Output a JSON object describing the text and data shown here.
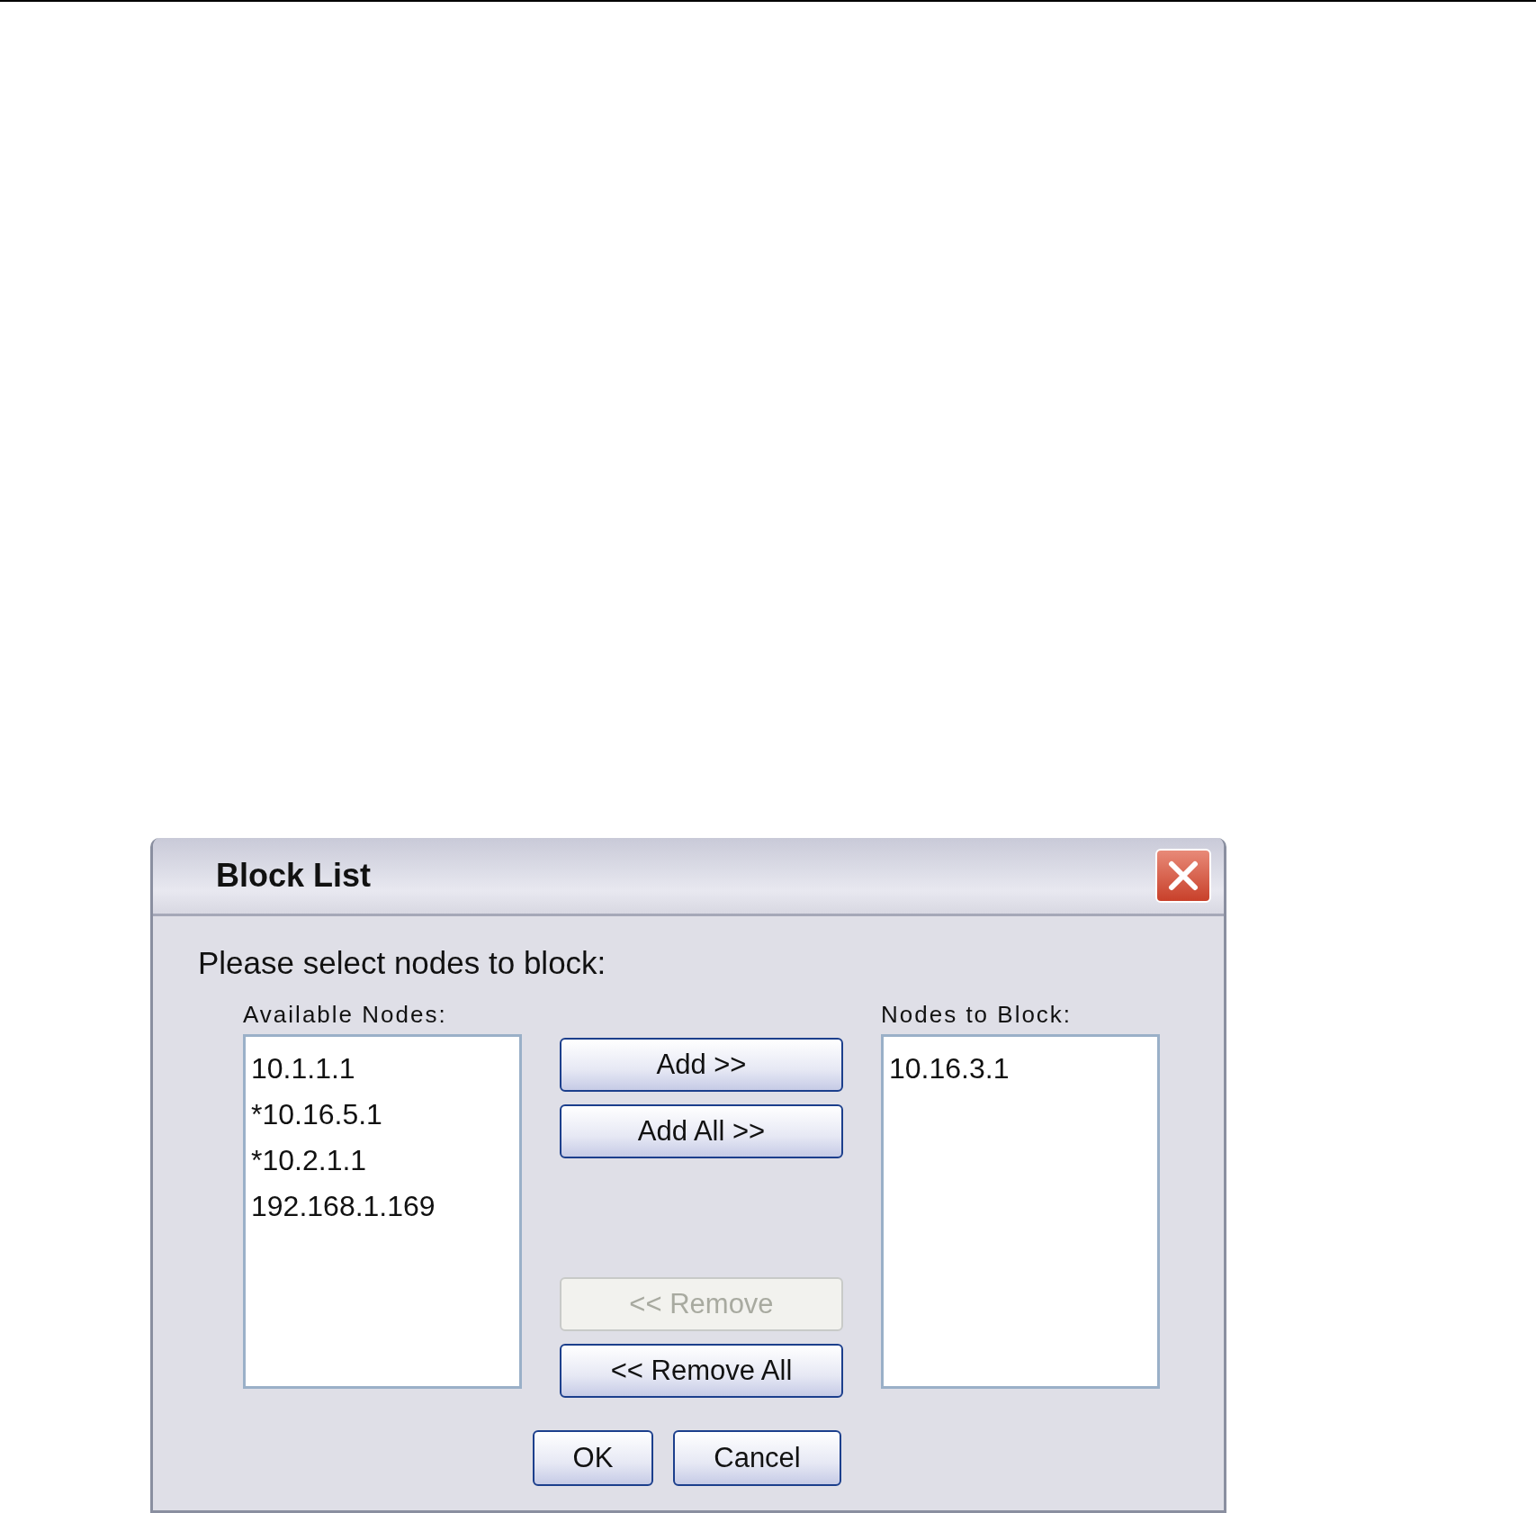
{
  "dialog": {
    "title": "Block List",
    "prompt": "Please select nodes to block:",
    "available": {
      "label": "Available Nodes:",
      "items": [
        "10.1.1.1",
        "*10.16.5.1",
        "*10.2.1.1",
        "192.168.1.169"
      ]
    },
    "move_buttons": [
      {
        "label": "Add >>",
        "disabled": false
      },
      {
        "label": "Add All >>",
        "disabled": false
      },
      {
        "label": "<< Remove",
        "disabled": true
      },
      {
        "label": "<< Remove All",
        "disabled": false
      }
    ],
    "blocked": {
      "label": "Nodes to Block:",
      "items": [
        "10.16.3.1"
      ]
    },
    "footer_buttons": [
      "OK",
      "Cancel"
    ]
  }
}
